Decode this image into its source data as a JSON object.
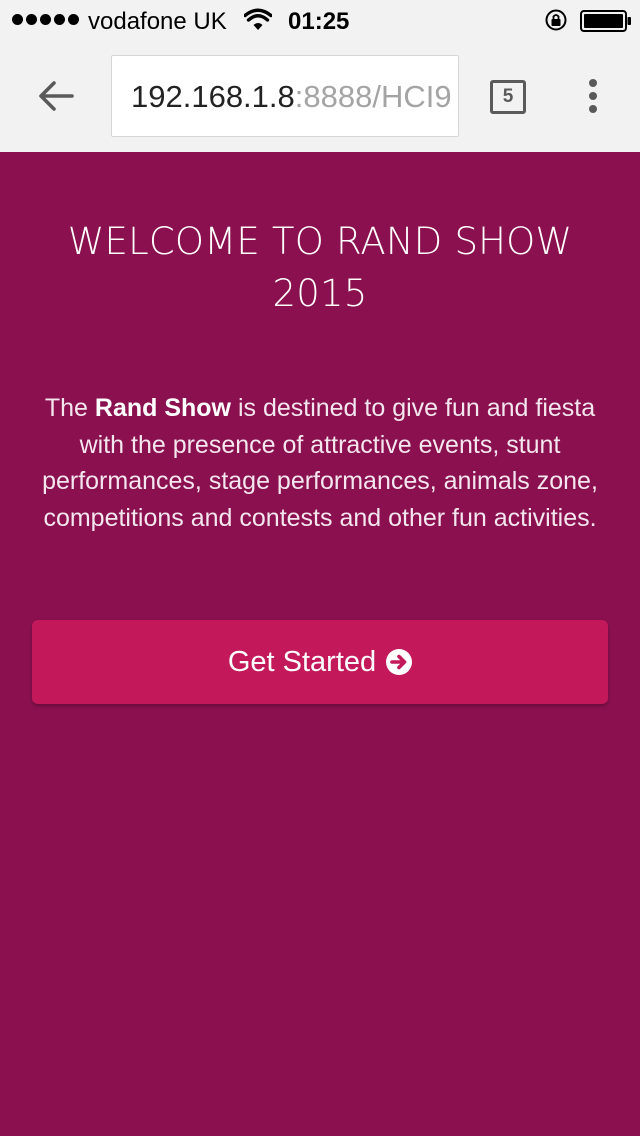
{
  "status_bar": {
    "carrier": "vodafone UK",
    "time": "01:25",
    "signal_bars": 5,
    "icons": [
      "signal-icon",
      "wifi-icon",
      "orientation-lock-icon",
      "battery-icon"
    ]
  },
  "browser": {
    "url_host": "192.168.1.8",
    "url_rest": ":8888/HCI9",
    "tab_count": "5",
    "icons": [
      "back-arrow-icon",
      "tabs-icon",
      "overflow-menu-icon"
    ]
  },
  "page": {
    "title": "WELCOME TO RAND SHOW 2015",
    "intro_prefix": "The ",
    "intro_bold": "Rand Show",
    "intro_suffix": " is destined to give fun and fiesta with the presence of attractive events, stunt performances, stage performances, animals zone, competitions and contests and other fun activities.",
    "cta_label": "Get Started",
    "cta_icon": "arrow-circle-right-icon"
  },
  "colors": {
    "background": "#8a104f",
    "button": "#c3185a",
    "browser_chrome": "#f2f2f2"
  }
}
